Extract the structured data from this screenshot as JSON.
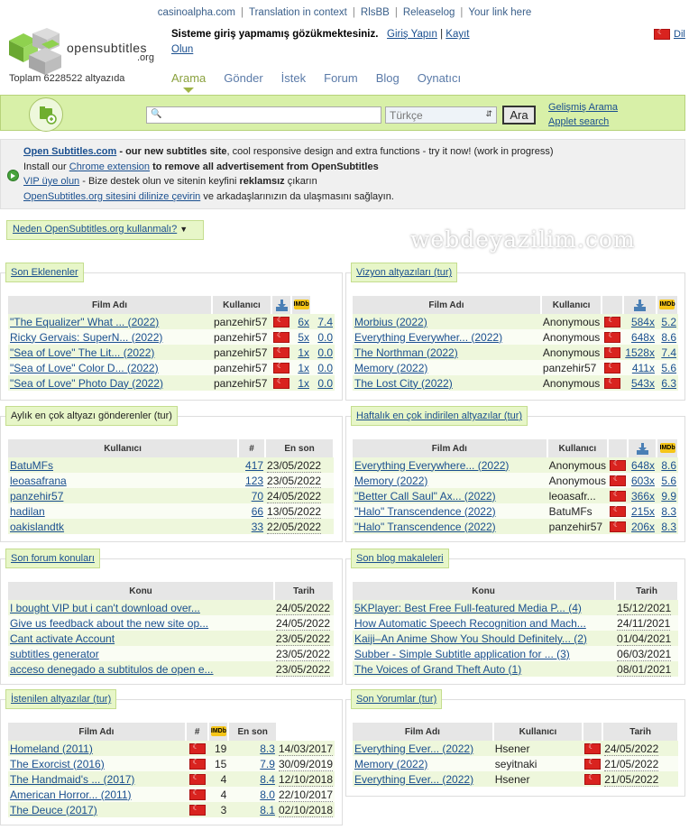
{
  "topbar": {
    "links": [
      "casinoalpha.com",
      "Translation in context",
      "RlsBB",
      "Releaselog",
      "Your link here"
    ]
  },
  "header": {
    "logo_text": "opensubtitles",
    "logo_sub": ".org",
    "total": "Toplam 6228522 altyazıda",
    "notice": "Sisteme giriş yapmamış gözükmektesiniz.",
    "login": "Giriş Yapın",
    "register": "Kayıt",
    "join": "Olun",
    "lang": "Dil"
  },
  "nav": {
    "items": [
      "Arama",
      "Gönder",
      "İstek",
      "Forum",
      "Blog",
      "Oynatıcı"
    ]
  },
  "search": {
    "placeholder": "",
    "language": "Türkçe",
    "button": "Ara",
    "advanced": "Gelişmiş Arama",
    "applet": "Applet search"
  },
  "info": {
    "line1_link": "Open Subtitles.com",
    "line1_rest": " - our new subtitles site",
    "line1_tail": ", cool responsive design and extra functions - try it now! (work in progress)",
    "line2_pre": "Install our ",
    "line2_link": "Chrome extension",
    "line2_post": " to remove all advertisement from OpenSubtitles",
    "line3_link": "VIP üye olun",
    "line3_mid": " - Bize destek olun ve sitenin keyfini ",
    "line3_bold": "reklamsız",
    "line3_post": " çıkarın",
    "line4_link": "OpenSubtitles.org sitesini dilinize çevirin",
    "line4_post": " ve arkadaşlarınızın da ulaşmasını sağlayın."
  },
  "why": "Neden OpenSubtitles.org kullanmalı?",
  "watermark": "webdeyazilim.com",
  "latest": {
    "title": "Son Eklenenler",
    "cols": [
      "Film Adı",
      "Kullanıcı"
    ],
    "rows": [
      {
        "film": "\"The Equalizer\" What ... (2022)",
        "user": "panzehir57",
        "dl": "6x",
        "rating": "7.4"
      },
      {
        "film": "Ricky Gervais: SuperN... (2022)",
        "user": "panzehir57",
        "dl": "5x",
        "rating": "0.0"
      },
      {
        "film": "\"Sea of Love\" The Lit... (2022)",
        "user": "panzehir57",
        "dl": "1x",
        "rating": "0.0"
      },
      {
        "film": "\"Sea of Love\" Color D... (2022)",
        "user": "panzehir57",
        "dl": "1x",
        "rating": "0.0"
      },
      {
        "film": "\"Sea of Love\" Photo Day (2022)",
        "user": "panzehir57",
        "dl": "1x",
        "rating": "0.0"
      }
    ]
  },
  "cinema": {
    "title": "Vizyon altyazıları (tur)",
    "cols": [
      "Film Adı",
      "Kullanıcı"
    ],
    "rows": [
      {
        "film": "Morbius (2022)",
        "user": "Anonymous",
        "dl": "584x",
        "rating": "5.2"
      },
      {
        "film": "Everything Everywher... (2022)",
        "user": "Anonymous",
        "dl": "648x",
        "rating": "8.6"
      },
      {
        "film": "The Northman (2022)",
        "user": "Anonymous",
        "dl": "1528x",
        "rating": "7.4"
      },
      {
        "film": "Memory (2022)",
        "user": "panzehir57",
        "dl": "411x",
        "rating": "5.6"
      },
      {
        "film": "The Lost City (2022)",
        "user": "Anonymous",
        "dl": "543x",
        "rating": "6.3"
      }
    ]
  },
  "uploaders": {
    "title": "Aylık en çok altyazı gönderenler (tur)",
    "cols": [
      "Kullanıcı",
      "#",
      "En son"
    ],
    "rows": [
      {
        "user": "BatuMFs",
        "count": "417",
        "date": "23/05/2022"
      },
      {
        "user": "leoasafrana",
        "count": "123",
        "date": "23/05/2022"
      },
      {
        "user": "panzehir57",
        "count": "70",
        "date": "24/05/2022"
      },
      {
        "user": "hadilan",
        "count": "66",
        "date": "13/05/2022"
      },
      {
        "user": "oakislandtk",
        "count": "33",
        "date": "22/05/2022"
      }
    ]
  },
  "weekly": {
    "title": "Haftalık en çok indirilen altyazılar (tur)",
    "cols": [
      "Film Adı",
      "Kullanıcı"
    ],
    "rows": [
      {
        "film": "Everything Everywhere... (2022)",
        "user": "Anonymous",
        "dl": "648x",
        "rating": "8.6"
      },
      {
        "film": "Memory (2022)",
        "user": "Anonymous",
        "dl": "603x",
        "rating": "5.6"
      },
      {
        "film": "\"Better Call Saul\" Ax... (2022)",
        "user": "leoasafr...",
        "dl": "366x",
        "rating": "9.9"
      },
      {
        "film": "\"Halo\" Transcendence (2022)",
        "user": "BatuMFs",
        "dl": "215x",
        "rating": "8.3"
      },
      {
        "film": "\"Halo\" Transcendence (2022)",
        "user": "panzehir57",
        "dl": "206x",
        "rating": "8.3"
      }
    ]
  },
  "forum": {
    "title": "Son forum konuları",
    "cols": [
      "Konu",
      "Tarih"
    ],
    "rows": [
      {
        "topic": "I bought VIP but i can't download over...",
        "date": "24/05/2022"
      },
      {
        "topic": "Give us feedback about the new site op...",
        "date": "24/05/2022"
      },
      {
        "topic": "Cant activate Account",
        "date": "23/05/2022"
      },
      {
        "topic": "subtitles generator",
        "date": "23/05/2022"
      },
      {
        "topic": "acceso denegado a subtitulos de open e...",
        "date": "23/05/2022"
      }
    ]
  },
  "blog": {
    "title": "Son blog makaleleri",
    "cols": [
      "Konu",
      "Tarih"
    ],
    "rows": [
      {
        "topic": "5KPlayer: Best Free Full-featured Media P... (4)",
        "date": "15/12/2021"
      },
      {
        "topic": "How Automatic Speech Recognition and Mach...",
        "date": "24/11/2021"
      },
      {
        "topic": "Kaiji–An Anime Show You Should Definitely... (2)",
        "date": "01/04/2021"
      },
      {
        "topic": "Subber - Simple Subtitle application for ... (3)",
        "date": "06/03/2021"
      },
      {
        "topic": "The Voices of Grand Theft Auto (1)",
        "date": "08/01/2021"
      }
    ]
  },
  "requests": {
    "title": "İstenilen altyazılar (tur)",
    "cols": [
      "Film Adı",
      "#",
      "En son"
    ],
    "rows": [
      {
        "film": "Homeland (2011)",
        "count": "19",
        "rating": "8.3",
        "date": "14/03/2017"
      },
      {
        "film": "The Exorcist (2016)",
        "count": "15",
        "rating": "7.9",
        "date": "30/09/2019"
      },
      {
        "film": "The Handmaid's ... (2017)",
        "count": "4",
        "rating": "8.4",
        "date": "12/10/2018"
      },
      {
        "film": "American Horror... (2011)",
        "count": "4",
        "rating": "8.0",
        "date": "22/10/2017"
      },
      {
        "film": "The Deuce (2017)",
        "count": "3",
        "rating": "8.1",
        "date": "02/10/2018"
      }
    ]
  },
  "comments": {
    "title": "Son Yorumlar (tur)",
    "cols": [
      "Film Adı",
      "Kullanıcı",
      "Tarih"
    ],
    "rows": [
      {
        "film": "Everything Ever... (2022)",
        "user": "Hsener",
        "date": "24/05/2022"
      },
      {
        "film": "Memory (2022)",
        "user": "seyitnaki",
        "date": "21/05/2022"
      },
      {
        "film": "Everything Ever... (2022)",
        "user": "Hsener",
        "date": "21/05/2022"
      }
    ]
  },
  "colors": {
    "green_bar": "#d8f0a8",
    "row_odd": "#eef7dc",
    "link": "#1a4f8f",
    "flag": "#d9231f"
  }
}
